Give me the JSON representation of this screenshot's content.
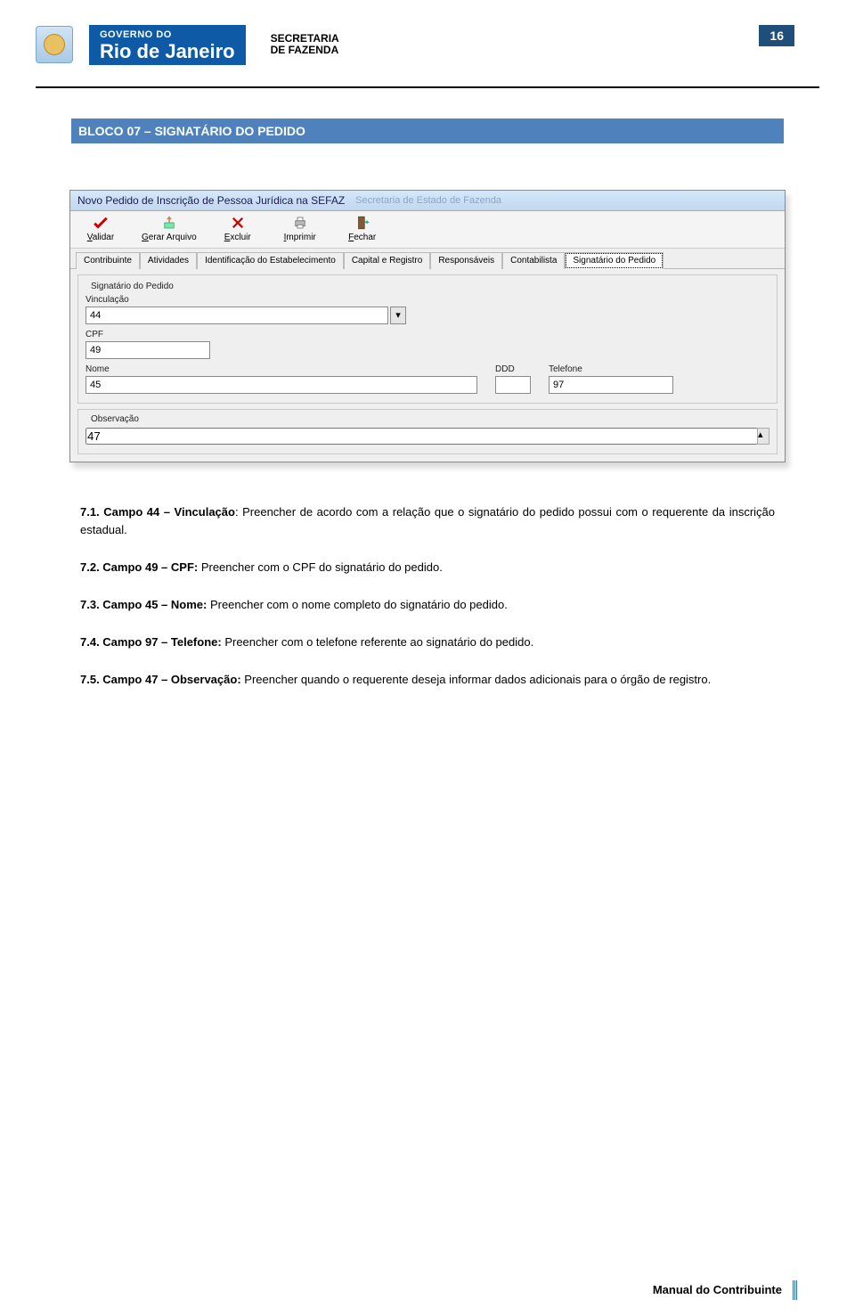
{
  "page_number": "16",
  "header": {
    "gov_line1": "GOVERNO DO",
    "gov_line2": "Rio de Janeiro",
    "secretariat_l1": "SECRETARIA",
    "secretariat_l2": "DE FAZENDA"
  },
  "section_title": "BLOCO 07 – SIGNATÁRIO DO PEDIDO",
  "window": {
    "title": "Novo Pedido de Inscrição de Pessoa Jurídica na SEFAZ",
    "subtitle": "Secretaria de Estado de Fazenda",
    "toolbar": {
      "validar": "Validar",
      "gerar": "Gerar Arquivo",
      "excluir": "Excluir",
      "imprimir": "Imprimir",
      "fechar": "Fechar"
    },
    "tabs": {
      "contribuinte": "Contribuinte",
      "atividades": "Atividades",
      "identificacao": "Identificação do Estabelecimento",
      "capital": "Capital e Registro",
      "responsaveis": "Responsáveis",
      "contabilista": "Contabilista",
      "signatario": "Signatário do Pedido"
    },
    "groupbox_title": "Signatário do Pedido",
    "labels": {
      "vinculacao": "Vinculação",
      "cpf": "CPF",
      "nome": "Nome",
      "ddd": "DDD",
      "telefone": "Telefone",
      "observacao": "Observação"
    },
    "values": {
      "vinculacao": "44",
      "cpf": "49",
      "nome": "45",
      "ddd": "",
      "telefone": "97",
      "observacao": "47"
    }
  },
  "paragraphs": {
    "p1_label": "7.1. Campo 44 – Vinculação",
    "p1_text": ": Preencher de acordo com a relação que o signatário do pedido possui com o requerente da inscrição estadual.",
    "p2_label": "7.2. Campo 49 – CPF:",
    "p2_text": " Preencher com o CPF do signatário do pedido.",
    "p3_label": "7.3. Campo 45 – Nome:",
    "p3_text": " Preencher com o nome completo do signatário do pedido.",
    "p4_label": "7.4. Campo 97 – Telefone:",
    "p4_text": " Preencher com o telefone referente ao signatário do pedido.",
    "p5_label": "7.5. Campo 47 – Observação:",
    "p5_text": " Preencher quando o requerente deseja informar dados adicionais para o órgão de registro."
  },
  "footer": "Manual do Contribuinte"
}
